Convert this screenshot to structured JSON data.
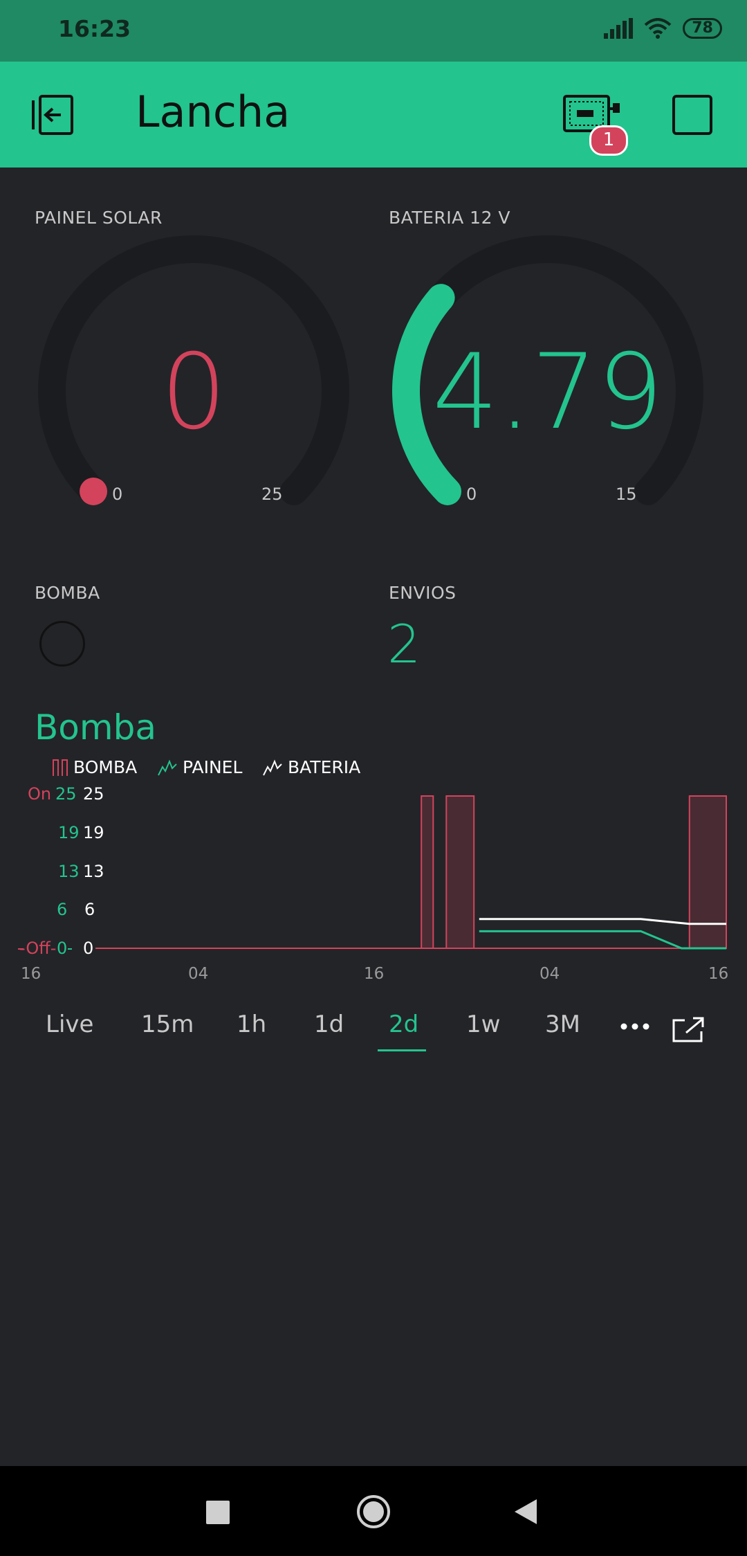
{
  "status": {
    "time": "16:23",
    "battery": "78"
  },
  "app": {
    "title": "Lancha",
    "device_badge": "1"
  },
  "gauges": [
    {
      "label": "PAINEL SOLAR",
      "value": "0",
      "min": "0",
      "max": "25",
      "fraction": 0.0,
      "color": "#d3435c"
    },
    {
      "label": "BATERIA 12 V",
      "value": "4.79",
      "min": "0",
      "max": "15",
      "fraction": 0.319,
      "color": "#23c48e"
    }
  ],
  "led": {
    "label": "BOMBA"
  },
  "envios": {
    "label": "ENVIOS",
    "value": "2"
  },
  "chart": {
    "title": "Bomba"
  },
  "chart_data": {
    "type": "line",
    "title": "Bomba",
    "legend": [
      "BOMBA",
      "PAINEL",
      "BATERIA"
    ],
    "x_ticks": [
      "16",
      "04",
      "16",
      "04",
      "16"
    ],
    "y_ticks_bomba": [
      "On",
      "-Off-"
    ],
    "y_ticks_painel": [
      "25",
      "19",
      "13",
      "6",
      "0"
    ],
    "y_ticks_bateria": [
      "25",
      "19",
      "13",
      "6",
      "0"
    ],
    "ylim": [
      0,
      25
    ],
    "x_range_hours": [
      0,
      48
    ],
    "series": [
      {
        "name": "BOMBA",
        "color": "#d3435c",
        "on_intervals": [
          [
            24.8,
            25.7
          ],
          [
            26.7,
            28.8
          ],
          [
            45.2,
            48
          ]
        ]
      },
      {
        "name": "PAINEL",
        "color": "#23c48e",
        "points": [
          [
            29.2,
            2.8
          ],
          [
            41.5,
            2.8
          ],
          [
            44.6,
            0
          ],
          [
            48,
            0
          ]
        ]
      },
      {
        "name": "BATERIA",
        "color": "#ffffff",
        "points": [
          [
            29.2,
            4.8
          ],
          [
            41.5,
            4.8
          ],
          [
            45.2,
            4.0
          ],
          [
            48,
            4.0
          ]
        ]
      }
    ]
  },
  "periods": [
    "Live",
    "15m",
    "1h",
    "1d",
    "2d",
    "1w",
    "3M"
  ],
  "active_period": "2d",
  "colors": {
    "accent": "#23c48e",
    "alert": "#d3435c",
    "background": "#232428",
    "header": "#23c48e"
  }
}
